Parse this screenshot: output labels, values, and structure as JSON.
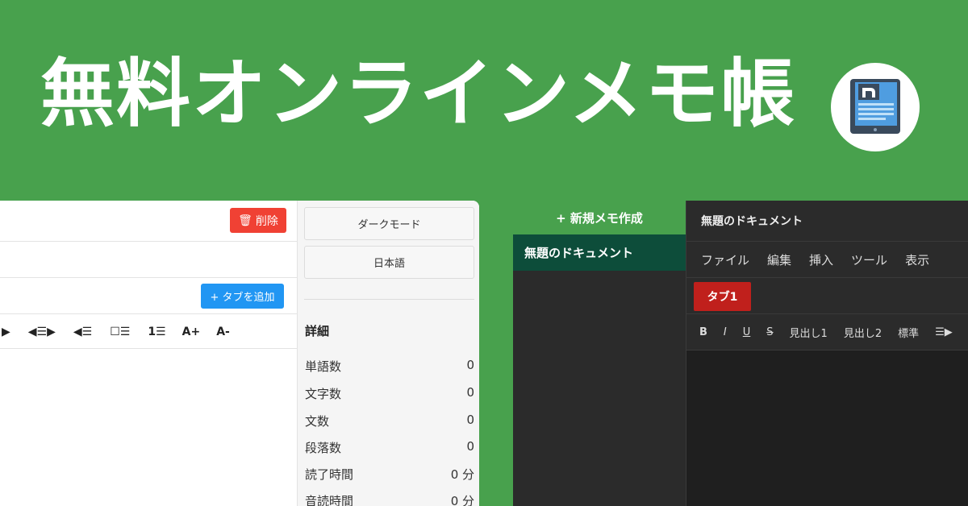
{
  "hero": {
    "title": "無料オンラインメモ帳"
  },
  "colors": {
    "brand_green": "#48a14d",
    "delete_red": "#f04134",
    "add_blue": "#2196f3",
    "tab_red": "#c0201c",
    "active_doc": "#0d4d3a"
  },
  "light": {
    "delete_label": "削除",
    "add_tab_label": "+ タブを追加",
    "toolbar": [
      "▶",
      "◀☰▶",
      "◀☰",
      "☐☰",
      "1☰",
      "A+",
      "A-"
    ],
    "sidebar": {
      "dark_mode": "ダークモード",
      "language": "日本語",
      "details_heading": "詳細",
      "stats": [
        {
          "label": "単語数",
          "value": "0"
        },
        {
          "label": "文字数",
          "value": "0"
        },
        {
          "label": "文数",
          "value": "0"
        },
        {
          "label": "段落数",
          "value": "0"
        },
        {
          "label": "読了時間",
          "value": "0 分"
        },
        {
          "label": "音読時間",
          "value": "0 分"
        }
      ]
    }
  },
  "dark": {
    "new_memo": "+ 新規メモ作成",
    "doc_item": "無題のドキュメント",
    "doc_title": "無題のドキュメント",
    "menu": [
      "ファイル",
      "編集",
      "挿入",
      "ツール",
      "表示"
    ],
    "tab": "タブ1",
    "toolbar": [
      "B",
      "I",
      "U",
      "S",
      "見出し1",
      "見出し2",
      "標準",
      "☰▶"
    ]
  }
}
